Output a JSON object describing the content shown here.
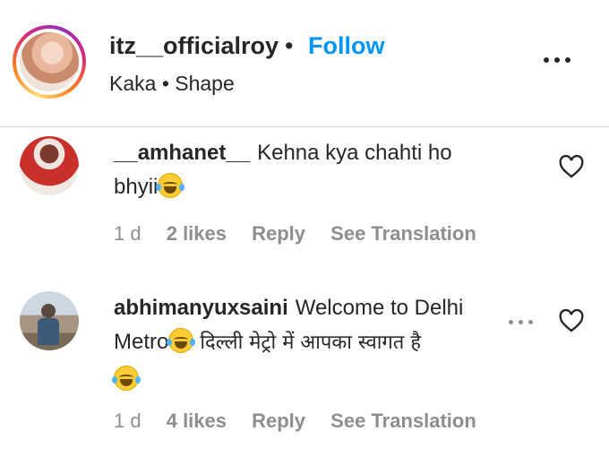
{
  "header": {
    "username": "itz__officialroy",
    "separator": "•",
    "follow_label": "Follow",
    "audio": "Kaka • Shape",
    "more_icon": "more-horizontal-icon"
  },
  "comments": [
    {
      "username": "__amhanet__",
      "text_line1": "Kehna kya chahti ho",
      "text_line2": "bhyii",
      "emoji": "face-with-tears-of-joy",
      "age": "1 d",
      "likes": "2 likes",
      "reply_label": "Reply",
      "translate_label": "See Translation"
    },
    {
      "username": "abhimanyuxsaini",
      "text_line1": "Welcome to Delhi",
      "text_line2a": "Metro",
      "text_line2b": " दिल्ली मेट्रो में आपका स्वागत है",
      "emoji": "face-with-tears-of-joy",
      "age": "1 d",
      "likes": "4 likes",
      "reply_label": "Reply",
      "translate_label": "See Translation"
    }
  ],
  "colors": {
    "follow": "#0095f6",
    "meta": "#8e8e8e",
    "text": "#262626",
    "divider": "#dbdbdb"
  }
}
